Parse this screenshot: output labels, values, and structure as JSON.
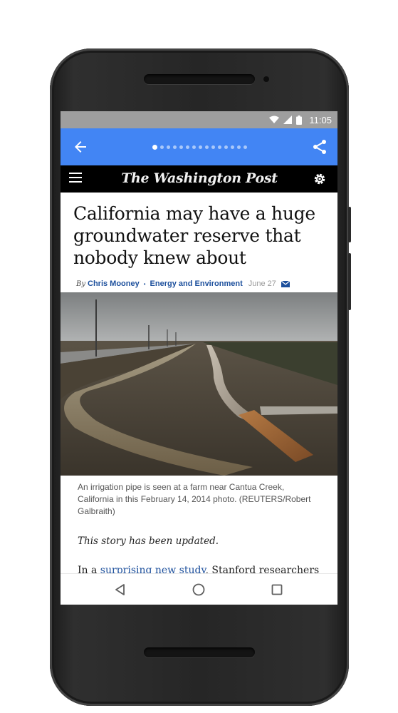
{
  "status_bar": {
    "time": "11:05",
    "icons": [
      "wifi-icon",
      "signal-icon",
      "battery-icon"
    ]
  },
  "app_bar": {
    "back_icon": "arrow-back-icon",
    "share_icon": "share-icon",
    "pager": {
      "count": 15,
      "active_index": 0
    },
    "color": "#4285f4"
  },
  "publication_bar": {
    "menu_icon": "hamburger-menu-icon",
    "logo_text": "The Washington Post",
    "settings_icon": "gear-icon"
  },
  "article": {
    "headline": "California may have a huge groundwater reserve that nobody knew about",
    "byline_prefix": "By",
    "author": "Chris Mooney",
    "separator": "•",
    "section": "Energy and Environment",
    "date": "June 27",
    "email_icon": "envelope-icon",
    "photo_description": "irrigation-pipe-photo",
    "caption": "An irrigation pipe is seen at a farm near Cantua Creek, California in this February 14, 2014 photo. (REUTERS/Robert Galbraith)",
    "update_note": "This story has been updated.",
    "body_start": "In a ",
    "body_link": "surprising new study",
    "body_rest": ", Stanford researchers"
  },
  "nav_bar": {
    "back_icon": "triangle-back-icon",
    "home_icon": "circle-home-icon",
    "recents_icon": "square-recents-icon"
  }
}
